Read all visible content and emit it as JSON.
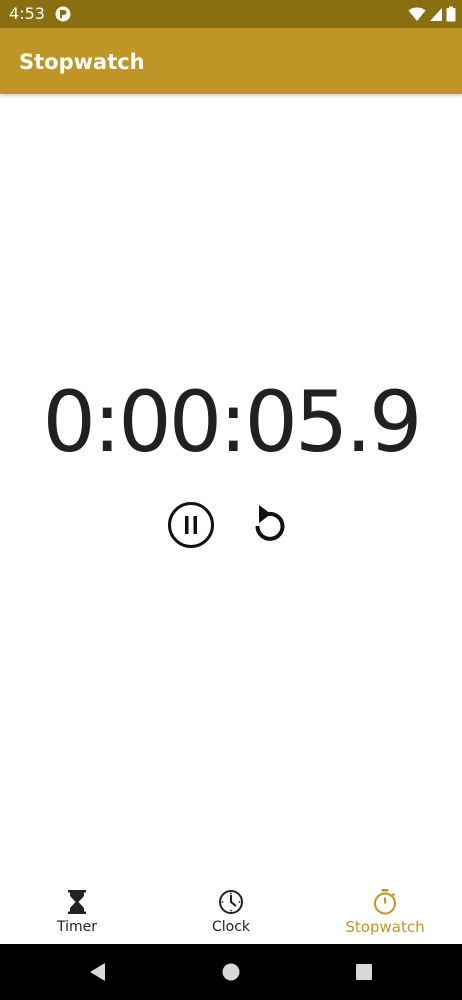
{
  "status_bar": {
    "time": "4:53",
    "background": "#8a6f10"
  },
  "app_bar": {
    "title": "Stopwatch",
    "background": "#bf9626"
  },
  "stopwatch": {
    "elapsed": "0:00:05.9",
    "pause_icon": "pause-circle-icon",
    "reset_icon": "reset-icon"
  },
  "bottom_nav": {
    "active_color": "#bf9626",
    "items": [
      {
        "label": "Timer",
        "icon": "hourglass-icon"
      },
      {
        "label": "Clock",
        "icon": "clock-icon"
      },
      {
        "label": "Stopwatch",
        "icon": "stopwatch-icon"
      }
    ]
  },
  "system_nav": {
    "buttons": [
      "back-icon",
      "home-icon",
      "recents-icon"
    ]
  }
}
